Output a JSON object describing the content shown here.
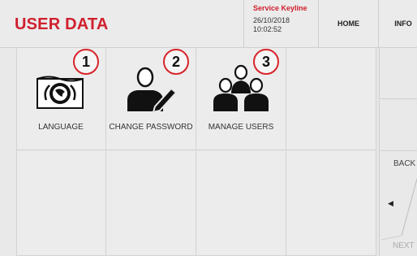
{
  "header": {
    "title": "USER DATA",
    "service_name": "Service Keyline",
    "date": "26/10/2018",
    "time": "10:02:52",
    "home_label": "HOME",
    "info_label": "INFO"
  },
  "tiles": [
    {
      "label": "LANGUAGE",
      "badge": "1",
      "icon": "flag-icon"
    },
    {
      "label": "CHANGE PASSWORD",
      "badge": "2",
      "icon": "user-pencil-icon"
    },
    {
      "label": "MANAGE USERS",
      "badge": "3",
      "icon": "users-group-icon"
    }
  ],
  "nav": {
    "back_label": "BACK",
    "next_label": "NEXT",
    "prev_arrow": "◀"
  },
  "colors": {
    "accent": "#d0202e",
    "background": "#e6e6e6"
  }
}
